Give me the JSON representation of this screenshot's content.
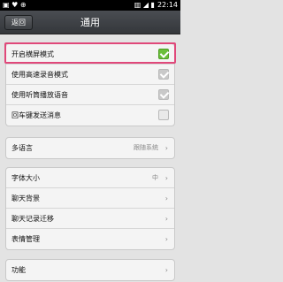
{
  "status_bar": {
    "left": "▣ ♥ ⊕",
    "right": "▥ ◢ ▮",
    "time": "22:14"
  },
  "header": {
    "back_label": "返回",
    "title": "通用"
  },
  "group1": {
    "items": [
      {
        "label": "开启横屏模式",
        "checked": true
      },
      {
        "label": "使用高速录音模式",
        "checked": true
      },
      {
        "label": "使用听筒播放语音",
        "checked": true
      },
      {
        "label": "回车键发送消息",
        "checked": false
      }
    ]
  },
  "group2": {
    "items": [
      {
        "label": "多语言",
        "value": "跟随系统",
        "chevron": "›"
      }
    ]
  },
  "group3": {
    "items": [
      {
        "label": "字体大小",
        "value": "中",
        "chevron": "›"
      },
      {
        "label": "聊天背景",
        "value": "",
        "chevron": "›"
      },
      {
        "label": "聊天记录迁移",
        "value": "",
        "chevron": "›"
      },
      {
        "label": "表情管理",
        "value": "",
        "chevron": "›"
      }
    ]
  },
  "group4": {
    "items": [
      {
        "label": "功能",
        "value": "",
        "chevron": "›"
      }
    ]
  }
}
